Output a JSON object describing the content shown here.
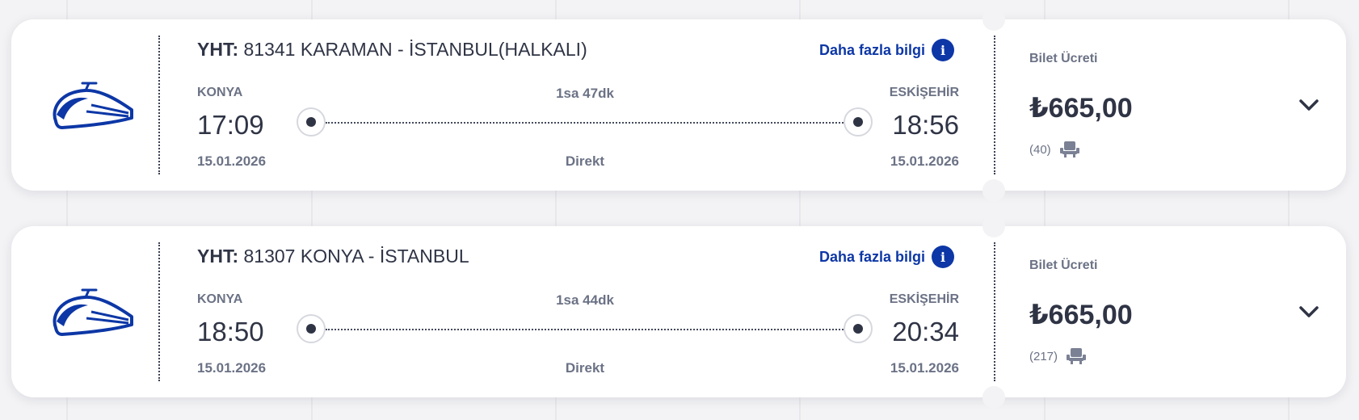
{
  "colors": {
    "brand": "#0d37a6",
    "text_dark": "#2f3445",
    "text_muted": "#6b7285",
    "card_bg": "#ffffff",
    "page_bg": "#f3f3f5"
  },
  "trips": [
    {
      "type_label": "YHT:",
      "train_name": "81341 KARAMAN - İSTANBUL(HALKALI)",
      "more_info": "Daha fazla bilgi",
      "info_icon": "i",
      "from_city": "KONYA",
      "to_city": "ESKİŞEHİR",
      "duration": "1sa 47dk",
      "dep_time": "17:09",
      "arr_time": "18:56",
      "dep_date": "15.01.2026",
      "arr_date": "15.01.2026",
      "stops": "Direkt",
      "fare_label": "Bilet Ücreti",
      "price": "₺665,00",
      "seats": "(40)",
      "icons": [
        "high-speed-train-icon",
        "info-icon",
        "seat-icon",
        "chevron-down-icon"
      ]
    },
    {
      "type_label": "YHT:",
      "train_name": "81307 KONYA - İSTANBUL",
      "more_info": "Daha fazla bilgi",
      "info_icon": "i",
      "from_city": "KONYA",
      "to_city": "ESKİŞEHİR",
      "duration": "1sa 44dk",
      "dep_time": "18:50",
      "arr_time": "20:34",
      "dep_date": "15.01.2026",
      "arr_date": "15.01.2026",
      "stops": "Direkt",
      "fare_label": "Bilet Ücreti",
      "price": "₺665,00",
      "seats": "(217)",
      "icons": [
        "high-speed-train-icon",
        "info-icon",
        "seat-icon",
        "chevron-down-icon"
      ]
    }
  ]
}
